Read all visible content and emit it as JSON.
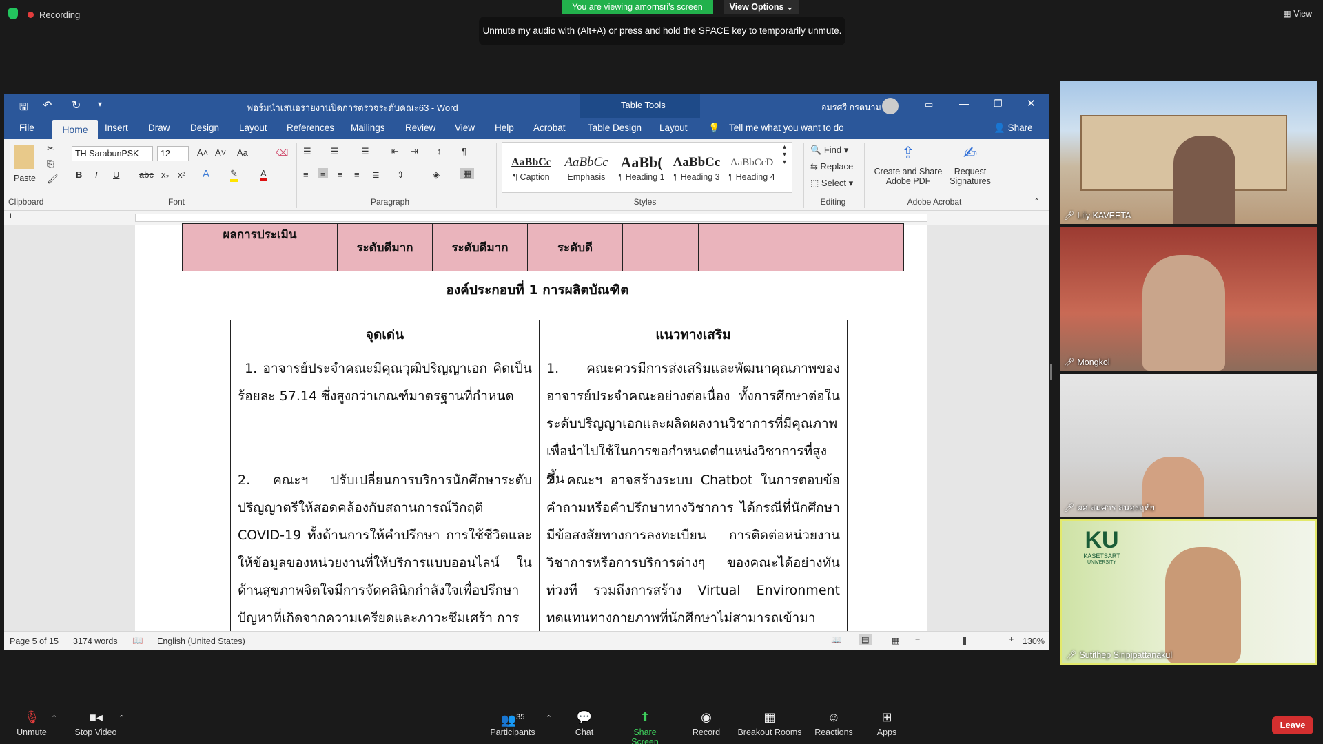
{
  "zoom": {
    "recording_label": "Recording",
    "viewing_banner": "You are viewing amornsri's screen",
    "view_options": "View Options",
    "unmute_tip": "Unmute my audio with (Alt+A) or press and hold the SPACE key to temporarily unmute.",
    "view_label": "View",
    "participants_count": "35",
    "toolbar": {
      "unmute": "Unmute",
      "stop_video": "Stop Video",
      "participants": "Participants",
      "chat": "Chat",
      "share_screen": "Share Screen",
      "record": "Record",
      "breakout": "Breakout Rooms",
      "reactions": "Reactions",
      "apps": "Apps",
      "leave": "Leave"
    },
    "participants_tiles": [
      {
        "name": "Lily KAVEETA"
      },
      {
        "name": "Mongkol"
      },
      {
        "name": "ผศ.สมศาร สนองฤทัย"
      },
      {
        "name": "Sutithep Siripipattanakul"
      }
    ],
    "ku_logo": {
      "letters": "KU",
      "line1": "KASETSART",
      "line2": "UNIVERSITY"
    }
  },
  "word": {
    "doc_title": "ฟอร์มนำเสนอรายงานปิดการตรวจระดับคณะ63 - Word",
    "table_tools": "Table Tools",
    "user": "อมรศรี กรตนาม",
    "tabs": [
      "File",
      "Home",
      "Insert",
      "Draw",
      "Design",
      "Layout",
      "References",
      "Mailings",
      "Review",
      "View",
      "Help",
      "Acrobat",
      "Table Design",
      "Layout"
    ],
    "tell_me": "Tell me what you want to do",
    "share": "Share",
    "ribbon": {
      "paste": "Paste",
      "clipboard": "Clipboard",
      "font_name": "TH SarabunPSK",
      "font_size": "12",
      "font": "Font",
      "paragraph": "Paragraph",
      "styles": "Styles",
      "editing": "Editing",
      "adobe": "Adobe Acrobat",
      "find": "Find",
      "replace": "Replace",
      "select": "Select",
      "create_share": "Create and Share",
      "adobe_pdf": "Adobe PDF",
      "request": "Request",
      "signatures": "Signatures",
      "style_items": [
        {
          "sample": "AaBbCc",
          "label": "¶ Caption"
        },
        {
          "sample": "AaBbCc",
          "label": "Emphasis"
        },
        {
          "sample": "AaBb(",
          "label": "¶ Heading 1"
        },
        {
          "sample": "AaBbCc",
          "label": "¶ Heading 3"
        },
        {
          "sample": "AaBbCcD",
          "label": "¶ Heading 4"
        }
      ]
    },
    "status": {
      "page": "Page 5 of 15",
      "words": "3174 words",
      "language": "English (United States)",
      "zoom": "130%"
    },
    "doc": {
      "top_row": {
        "c1": "ผลการประเมิน",
        "c2": "ระดับดีมาก",
        "c3": "ระดับดีมาก",
        "c4": "ระดับดี"
      },
      "heading": "องค์ประกอบที่ 1 การผลิตบัณฑิต",
      "col1_head": "จุดเด่น",
      "col2_head": "แนวทางเสริม",
      "strength1": "1. อาจารย์ประจำคณะมีคุณวุฒิปริญญาเอก คิดเป็นร้อยละ 57.14 ซึ่งสูงกว่าเกณฑ์มาตรฐานที่กำหนด",
      "suggest1": "1. คณะควรมีการส่งเสริมและพัฒนาคุณภาพของอาจารย์ประจำคณะอย่างต่อเนื่อง ทั้งการศึกษาต่อในระดับปริญญาเอกและผลิตผลงานวิชาการที่มีคุณภาพเพื่อนำไปใช้ในการขอกำหนดตำแหน่งวิชาการที่สูงขึ้น",
      "strength2": "2. คณะฯ ปรับเปลี่ยนการบริการนักศึกษาระดับปริญญาตรีให้สอดคล้องกับสถานการณ์วิกฤติ COVID-19 ทั้งด้านการให้คำปรึกษา การใช้ชีวิตและให้ข้อมูลของหน่วยงานที่ให้บริการแบบออนไลน์ ในด้านสุขภาพจิตใจมีการจัดคลินิกกำลังใจเพื่อปรึกษาปัญหาที่เกิดจากความเครียดและภาวะซึมเศร้า การ",
      "suggest2": "2. คณะฯ อาจสร้างระบบ Chatbot ในการตอบข้อคำถามหรือคำปรึกษาทางวิชาการ ได้กรณีที่นักศึกษามีข้อสงสัยทางการลงทะเบียน การติดต่อหน่วยงานวิชาการหรือการบริการต่างๆ ของคณะได้อย่างทันท่วงที รวมถึงการสร้าง Virtual Environment ทดแทนทางกายภาพที่นักศึกษาไม่สามารถเข้ามา"
    }
  }
}
